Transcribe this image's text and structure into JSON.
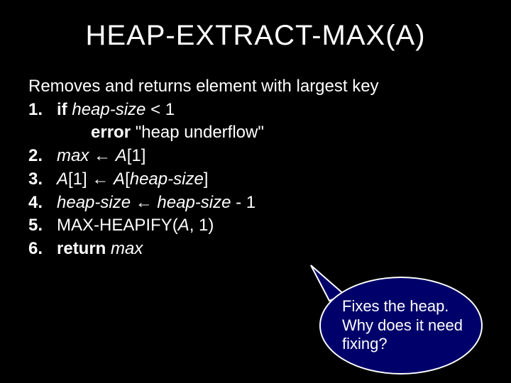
{
  "title": "HEAP-EXTRACT-MAX(A)",
  "subtitle": "Removes and returns element with largest key",
  "steps": {
    "n1": "1.",
    "s1_if": "if",
    "s1_cond_a": "heap-size",
    "s1_cond_b": " < 1",
    "err_kw": "error",
    "err_msg": " \"heap underflow\"",
    "n2": "2.",
    "s2_a": "max",
    "s2_b": " ← ",
    "s2_c": "A",
    "s2_d": "[1]",
    "n3": "3.",
    "s3_a": "A",
    "s3_b": "[1] ← ",
    "s3_c": "A",
    "s3_d": "[",
    "s3_e": "heap-size",
    "s3_f": "]",
    "n4": "4.",
    "s4_a": "heap-size",
    "s4_b": " ← ",
    "s4_c": "heap-size",
    "s4_d": " - 1",
    "n5": "5.",
    "s5_a": "MAX-HEAPIFY(",
    "s5_b": "A",
    "s5_c": ", 1)",
    "n6": "6.",
    "s6_kw": "return",
    "s6_a": " ",
    "s6_b": "max"
  },
  "callout": "Fixes the heap. Why does it need fixing?"
}
